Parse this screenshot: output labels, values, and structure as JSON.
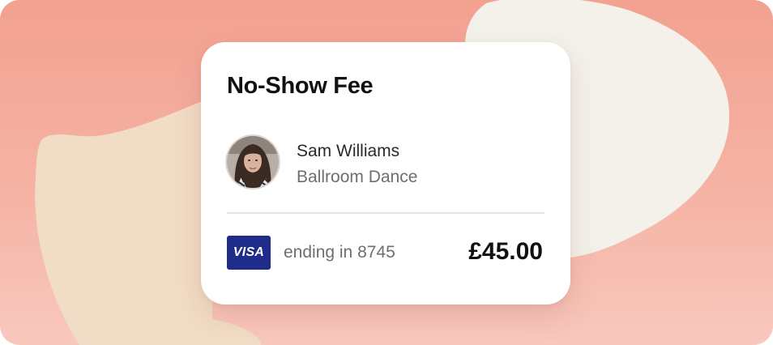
{
  "card": {
    "title": "No-Show Fee",
    "client": {
      "name": "Sam Williams",
      "service": "Ballroom Dance",
      "avatar_icon": "client-avatar-photo"
    },
    "payment": {
      "brand": "VISA",
      "ending_text": "ending in 8745",
      "amount": "£45.00"
    }
  },
  "colors": {
    "background_top": "#f3a190",
    "background_bottom": "#f8c8bd",
    "blob_cream": "#f1dcc5",
    "blob_light": "#f3f1ea",
    "card": "#ffffff",
    "visa_blue": "#1f2c8a",
    "text_dark": "#111111",
    "text_muted": "#6e6e6e"
  }
}
